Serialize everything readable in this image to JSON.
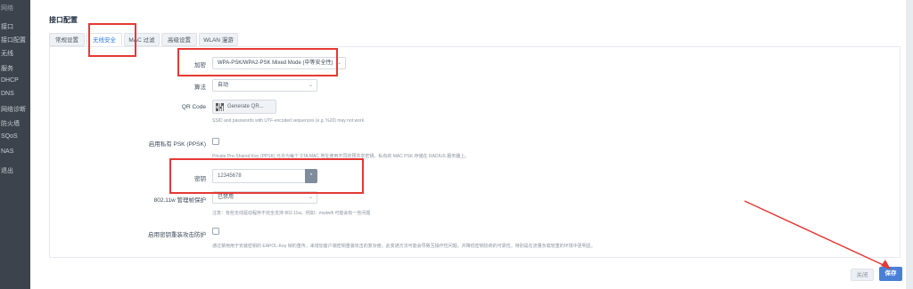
{
  "sidebar": {
    "items": [
      "网络",
      "接口",
      "接口配置",
      "无线",
      "服务",
      "DHCP",
      "DNS",
      "网络诊断",
      "防火墙",
      "SQoS",
      "NAS",
      "退出"
    ]
  },
  "section_title": "接口配置",
  "tabs": [
    {
      "label": "常规设置"
    },
    {
      "label": "无线安全"
    },
    {
      "label": "MAC 过滤"
    },
    {
      "label": "高级设置"
    },
    {
      "label": "WLAN 漫游"
    }
  ],
  "form": {
    "encryption": {
      "label": "加密",
      "value": "WPA-PSK/WPA2-PSK Mixed Mode (中等安全性)"
    },
    "cipher": {
      "label": "算法",
      "value": "自动"
    },
    "qr": {
      "label": "QR Code",
      "button": "Generate QR...",
      "hint": "SSID and passwords with UTF-encoded sequences (e.g. %20) may not work."
    },
    "ppsk": {
      "label": "启用私有 PSK (PPSK)",
      "hint": "Private Pre-Shared Key (PPSK) 允许为每个 STA MAC 地址使用不同的预共享密钥。私有的 MAC PSK 存储在 RADIUS 服务器上。"
    },
    "key": {
      "label": "密钥",
      "value": "12345678",
      "toggle": "*"
    },
    "mfp": {
      "label": "802.11w 管理帧保护",
      "value": "已禁用",
      "hint": "注意：有些无线驱动程序不完全支持 802.11w。例如：mwlwifi 可能会有一些问题"
    },
    "krack": {
      "label": "启用密钥重装攻击防护",
      "hint": "通过禁用用于安装密钥的 EAPOL-Key 帧的重传，来增加客户端密钥重装攻击的复杂度。此变通方法可能会导致互操作性问题，并降低密钥协商的可靠性，特别是在流量负载较重的环境中更明显。"
    }
  },
  "footer": {
    "close": "关闭",
    "save": "保存"
  },
  "colors": {
    "annotation": "#e53935",
    "primary": "#4a7fd6"
  }
}
